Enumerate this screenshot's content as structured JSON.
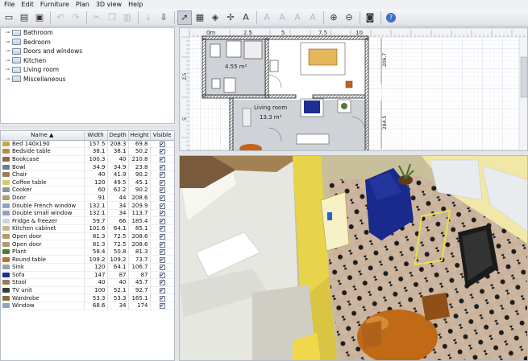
{
  "menu": [
    "File",
    "Edit",
    "Furniture",
    "Plan",
    "3D view",
    "Help"
  ],
  "toolbar": [
    {
      "icon": "new-file-icon",
      "enabled": true
    },
    {
      "icon": "open-icon",
      "enabled": true
    },
    {
      "icon": "save-icon",
      "enabled": true
    },
    {
      "sep": true
    },
    {
      "icon": "undo-icon",
      "enabled": false
    },
    {
      "icon": "redo-icon",
      "enabled": false
    },
    {
      "sep": true
    },
    {
      "icon": "cut-icon",
      "enabled": false
    },
    {
      "icon": "copy-icon",
      "enabled": false
    },
    {
      "icon": "paste-icon",
      "enabled": false
    },
    {
      "sep": true
    },
    {
      "icon": "add-furniture-icon",
      "enabled": false
    },
    {
      "icon": "import-furniture-icon",
      "enabled": true
    },
    {
      "sep": true
    },
    {
      "icon": "select-mode-icon",
      "enabled": true,
      "pressed": true
    },
    {
      "icon": "create-walls-icon",
      "enabled": true
    },
    {
      "icon": "create-rooms-icon",
      "enabled": true
    },
    {
      "icon": "create-dimensions-icon",
      "enabled": true
    },
    {
      "icon": "add-text-icon",
      "enabled": true
    },
    {
      "sep": true
    },
    {
      "icon": "increase-text-size-icon",
      "enabled": false
    },
    {
      "icon": "decrease-text-size-icon",
      "enabled": false
    },
    {
      "icon": "bold-text-icon",
      "enabled": false
    },
    {
      "icon": "italic-text-icon",
      "enabled": false
    },
    {
      "sep": true
    },
    {
      "icon": "zoom-in-icon",
      "enabled": true
    },
    {
      "icon": "zoom-out-icon",
      "enabled": true
    },
    {
      "sep": true
    },
    {
      "icon": "create-photo-icon",
      "enabled": true
    },
    {
      "sep": true
    },
    {
      "icon": "help-icon",
      "enabled": true
    }
  ],
  "catalog": [
    "Bathroom",
    "Bedroom",
    "Doors and windows",
    "Kitchen",
    "Living room",
    "Miscellaneous"
  ],
  "furniture_columns": [
    "Name ▲",
    "Width",
    "Depth",
    "Height",
    "Visible"
  ],
  "furniture": [
    {
      "name": "Bed 140x190",
      "width": "157.5",
      "depth": "208.3",
      "height": "69.8",
      "color": "#c9a640"
    },
    {
      "name": "Bedside table",
      "width": "38.1",
      "depth": "38.1",
      "height": "50.2",
      "color": "#b88a4a"
    },
    {
      "name": "Bookcase",
      "width": "100.3",
      "depth": "40",
      "height": "210.8",
      "color": "#8c6a3f"
    },
    {
      "name": "Bowl",
      "width": "34.9",
      "depth": "34.9",
      "height": "23.8",
      "color": "#6d7a8c"
    },
    {
      "name": "Chair",
      "width": "40",
      "depth": "41.9",
      "height": "90.2",
      "color": "#9a7a56"
    },
    {
      "name": "Coffee table",
      "width": "120",
      "depth": "49.5",
      "height": "45.1",
      "color": "#d8c870"
    },
    {
      "name": "Cooker",
      "width": "60",
      "depth": "62.2",
      "height": "90.2",
      "color": "#8d949e"
    },
    {
      "name": "Door",
      "width": "91",
      "depth": "44",
      "height": "208.6",
      "color": "#b39a6a"
    },
    {
      "name": "Double French window",
      "width": "132.1",
      "depth": "34",
      "height": "209.9",
      "color": "#8ea4c2"
    },
    {
      "name": "Double small window",
      "width": "132.1",
      "depth": "34",
      "height": "113.7",
      "color": "#8ea4c2"
    },
    {
      "name": "Fridge & freezer",
      "width": "59.7",
      "depth": "66",
      "height": "185.4",
      "color": "#cfd4da"
    },
    {
      "name": "Kitchen cabinet",
      "width": "101.6",
      "depth": "64.1",
      "height": "85.1",
      "color": "#c9b58a"
    },
    {
      "name": "Open door",
      "width": "81.3",
      "depth": "72.5",
      "height": "208.6",
      "color": "#b39a6a"
    },
    {
      "name": "Open door",
      "width": "81.3",
      "depth": "72.5",
      "height": "208.6",
      "color": "#b39a6a"
    },
    {
      "name": "Plant",
      "width": "58.4",
      "depth": "50.8",
      "height": "81.3",
      "color": "#4f7a38"
    },
    {
      "name": "Round table",
      "width": "109.2",
      "depth": "109.2",
      "height": "73.7",
      "color": "#b8742c"
    },
    {
      "name": "Sink",
      "width": "120",
      "depth": "64.1",
      "height": "106.7",
      "color": "#9aa3ad"
    },
    {
      "name": "Sofa",
      "width": "147",
      "depth": "87",
      "height": "87",
      "color": "#1f2f8f"
    },
    {
      "name": "Stool",
      "width": "40",
      "depth": "40",
      "height": "45.7",
      "color": "#9a7a56"
    },
    {
      "name": "TV unit",
      "width": "100",
      "depth": "52.1",
      "height": "92.7",
      "color": "#3a3a3a"
    },
    {
      "name": "Wardrobe",
      "width": "53.3",
      "depth": "53.3",
      "height": "165.1",
      "color": "#8c6a3f"
    },
    {
      "name": "Window",
      "width": "68.6",
      "depth": "34",
      "height": "174",
      "color": "#8ea4c2"
    }
  ],
  "visible_mark": "✔",
  "plan": {
    "ruler_zero": "0m",
    "ruler_marks": [
      "2.5",
      "5",
      "7.5",
      "10"
    ],
    "side_marks": [
      "2.5",
      "5"
    ],
    "room1_area": "4.55 m²",
    "room2_name": "Living room",
    "room2_area": "13.3 m²",
    "dim1": "206.7",
    "dim2": "284.5"
  }
}
